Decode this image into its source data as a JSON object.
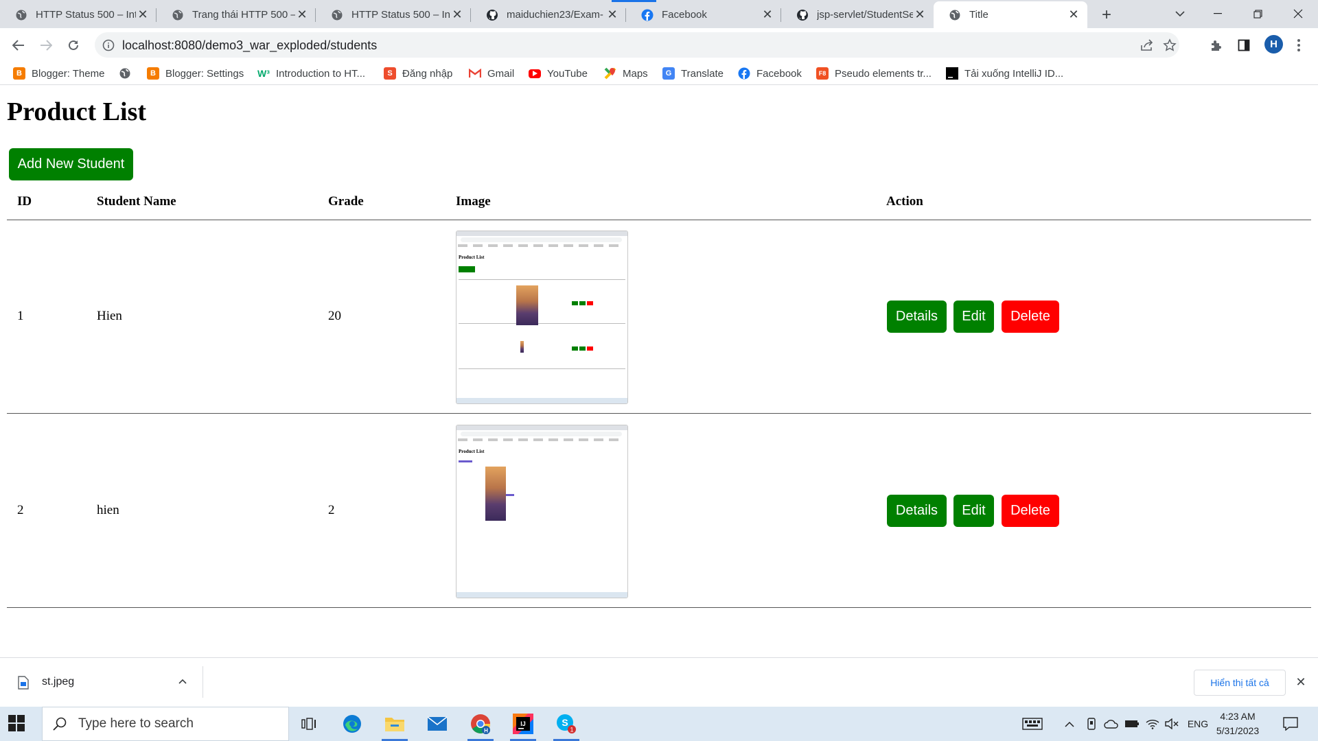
{
  "browser": {
    "tabs": [
      {
        "title": "HTTP Status 500 – Inte",
        "icon": "globe-icon"
      },
      {
        "title": "Trang thái HTTP 500 –",
        "icon": "globe-icon"
      },
      {
        "title": "HTTP Status 500 – Inte",
        "icon": "globe-icon"
      },
      {
        "title": "maiduchien23/Exam-",
        "icon": "github-icon"
      },
      {
        "title": "Facebook",
        "icon": "facebook-icon"
      },
      {
        "title": "jsp-servlet/StudentSe",
        "icon": "github-icon"
      },
      {
        "title": "Title",
        "icon": "globe-icon",
        "active": true
      }
    ],
    "url": "localhost:8080/demo3_war_exploded/students",
    "profile_initial": "H",
    "bookmarks": [
      {
        "label": "Blogger: Theme",
        "icon": "blogger-icon"
      },
      {
        "label": "",
        "icon": "globe-icon"
      },
      {
        "label": "Blogger: Settings",
        "icon": "blogger-icon"
      },
      {
        "label": "Introduction to HT...",
        "icon": "w3-icon"
      },
      {
        "label": "Đăng nhập",
        "icon": "shopee-icon"
      },
      {
        "label": "Gmail",
        "icon": "gmail-icon"
      },
      {
        "label": "YouTube",
        "icon": "youtube-icon"
      },
      {
        "label": "Maps",
        "icon": "maps-icon"
      },
      {
        "label": "Translate",
        "icon": "translate-icon"
      },
      {
        "label": "Facebook",
        "icon": "facebook-icon"
      },
      {
        "label": "Pseudo elements tr...",
        "icon": "f8-icon"
      },
      {
        "label": "Tải xuống IntelliJ ID...",
        "icon": "intellij-icon"
      }
    ]
  },
  "page": {
    "title": "Product List",
    "add_button": "Add New Student",
    "columns": [
      "ID",
      "Student Name",
      "Grade",
      "Image",
      "Action"
    ],
    "rows": [
      {
        "id": "1",
        "name": "Hien",
        "grade": "20"
      },
      {
        "id": "2",
        "name": "hien",
        "grade": "2"
      }
    ],
    "actions": {
      "details": "Details",
      "edit": "Edit",
      "delete": "Delete"
    },
    "thumb_title": "Product List",
    "colors": {
      "green": "#008000",
      "red": "#ff0000"
    }
  },
  "downloads": {
    "file": "st.jpeg",
    "show_all": "Hiển thị tất cả"
  },
  "taskbar": {
    "search_placeholder": "Type here to search",
    "language": "ENG",
    "time": "4:23 AM",
    "date": "5/31/2023",
    "apps": [
      "task-view-icon",
      "edge-icon",
      "file-explorer-icon",
      "mail-icon",
      "chrome-icon",
      "intellij-icon",
      "skype-icon"
    ]
  }
}
